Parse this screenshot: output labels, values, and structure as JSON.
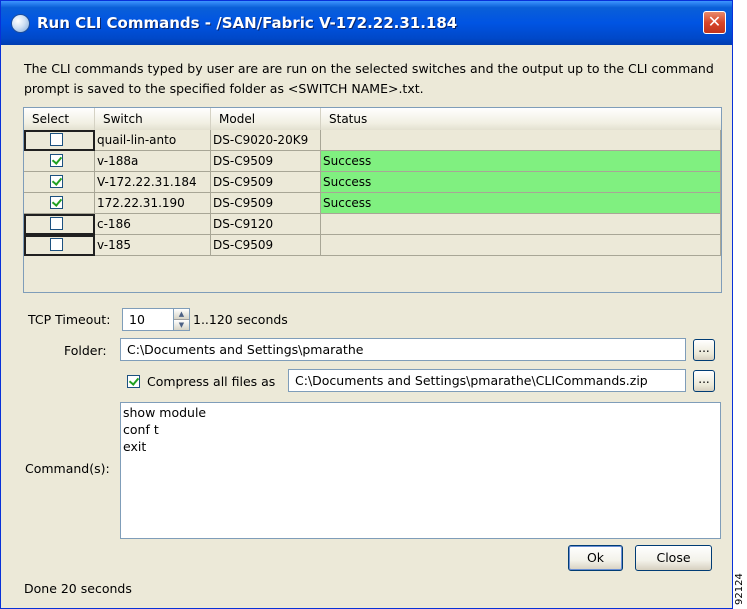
{
  "window": {
    "title": "Run CLI Commands - /SAN/Fabric V-172.22.31.184",
    "close_glyph": "✕"
  },
  "description": "The CLI commands typed by user are are run on the selected switches and the output up to the CLI command prompt is saved to the specified folder as <SWITCH NAME>.txt.",
  "table": {
    "columns": [
      "Select",
      "Switch",
      "Model",
      "Status"
    ],
    "rows": [
      {
        "selected": false,
        "switch": "quail-lin-anto",
        "model": "DS-C9020-20K9",
        "status": ""
      },
      {
        "selected": true,
        "switch": "v-188a",
        "model": "DS-C9509",
        "status": "Success"
      },
      {
        "selected": true,
        "switch": "V-172.22.31.184",
        "model": "DS-C9509",
        "status": "Success"
      },
      {
        "selected": true,
        "switch": "172.22.31.190",
        "model": "DS-C9509",
        "status": "Success"
      },
      {
        "selected": false,
        "switch": "c-186",
        "model": "DS-C9120",
        "status": ""
      },
      {
        "selected": false,
        "switch": "v-185",
        "model": "DS-C9509",
        "status": ""
      }
    ],
    "success_color": "#80f080"
  },
  "form": {
    "tcp_timeout_label": "TCP Timeout:",
    "tcp_timeout_value": "10",
    "tcp_timeout_range": "1..120 seconds",
    "folder_label": "Folder:",
    "folder_value": "C:\\Documents and Settings\\pmarathe",
    "browse_label": "...",
    "compress_checked": true,
    "compress_label": "Compress all files as",
    "compress_value": "C:\\Documents and Settings\\pmarathe\\CLICommands.zip",
    "commands_label": "Command(s):",
    "commands": [
      "show module",
      "conf t",
      "exit"
    ]
  },
  "buttons": {
    "ok": "Ok",
    "close": "Close"
  },
  "status_text": "Done 20 seconds",
  "figure_number": "92124",
  "icons": {
    "title": "app-globe-icon",
    "close": "close-icon",
    "spin_up": "spin-up-icon",
    "spin_down": "spin-down-icon"
  }
}
